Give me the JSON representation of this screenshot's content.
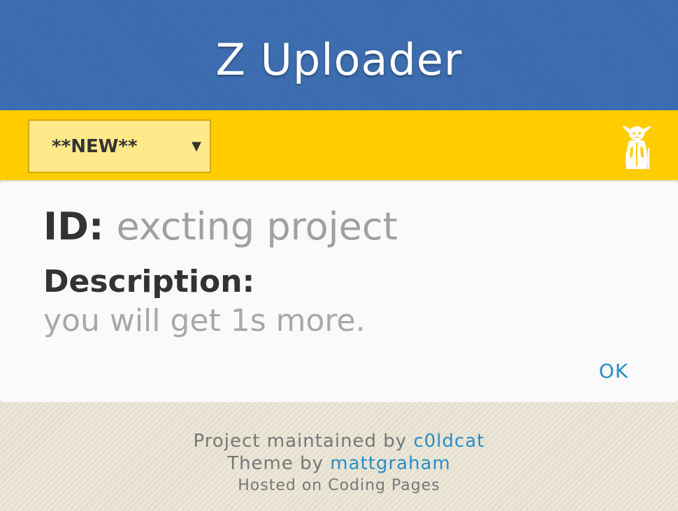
{
  "header": {
    "title": "Z Uploader"
  },
  "toolbar": {
    "project_select": {
      "selected": "**NEW**",
      "arrow": "▼"
    },
    "avatar_icon": "yoda-icon"
  },
  "project": {
    "id_label": "ID:",
    "id_value": "excting project",
    "description_label": "Description:",
    "description_value": "you will get 1s more.",
    "ok_label": "OK"
  },
  "footer": {
    "maintained_prefix": "Project maintained by",
    "maintainer": "c0ldcat",
    "theme_prefix": "Theme by",
    "theme_author": "mattgraham",
    "hosted": "Hosted on Coding Pages"
  },
  "colors": {
    "header_bg": "#3b6cb0",
    "toolbar_bg": "#ffcc00",
    "select_bg": "#ffe98a",
    "link": "#2b8dc4",
    "footer_bg": "#e8e3d2"
  }
}
